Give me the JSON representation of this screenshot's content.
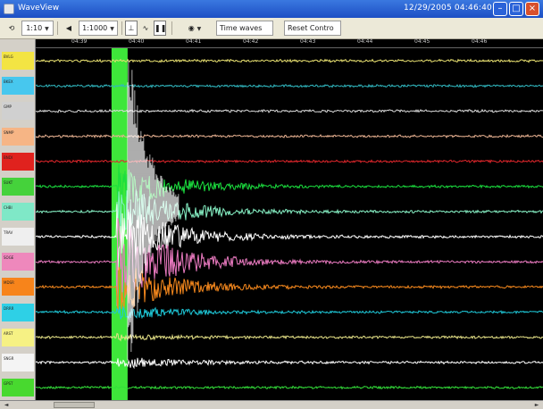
{
  "window": {
    "title": "WaveView",
    "timestamp": "12/29/2005 04:46:40",
    "minimize_icon": "minimize-icon",
    "maximize_icon": "maximize-icon",
    "close_icon": "close-icon"
  },
  "toolbar": {
    "zoom_value": "1:10",
    "scale_value": "1:1000",
    "time_button_label": "Time waves",
    "reset_button_label": "Reset Contro",
    "icons": [
      "reset-icon",
      "arrow-back-icon",
      "zoom-dropdown-icon",
      "filter-icon",
      "wave-icon",
      "pause-icon",
      "display-options-icon"
    ]
  },
  "time_axis": {
    "ticks": [
      "04:39",
      "04:40",
      "04:41",
      "04:42",
      "04:43",
      "04:44",
      "04:45",
      "04:46"
    ]
  },
  "channels": [
    {
      "name": "BVLG",
      "label_color": "#f3e443",
      "trace_color": "#e8e070",
      "amplitude": 0.0
    },
    {
      "name": "BKEX",
      "label_color": "#47c7ee",
      "trace_color": "#31b8c0",
      "amplitude": 0.0
    },
    {
      "name": "GMP",
      "label_color": "#d0d0d0",
      "trace_color": "#d8d8d8",
      "amplitude": 0.0
    },
    {
      "name": "SNMP",
      "label_color": "#f6b585",
      "trace_color": "#e9b292",
      "amplitude": 0.0
    },
    {
      "name": "BNDI",
      "label_color": "#e0221e",
      "trace_color": "#e0262b",
      "amplitude": 0.0
    },
    {
      "name": "SUKT",
      "label_color": "#45d23b",
      "trace_color": "#1bde3e",
      "amplitude": 0.45
    },
    {
      "name": "CHBI",
      "label_color": "#7fe8c7",
      "trace_color": "#86f0c4",
      "amplitude": 0.55
    },
    {
      "name": "TRAV",
      "label_color": "#efefef",
      "trace_color": "#ffffff",
      "amplitude": 0.65
    },
    {
      "name": "SOGE",
      "label_color": "#ee88bc",
      "trace_color": "#ea7ac0",
      "amplitude": 0.8
    },
    {
      "name": "MDSR",
      "label_color": "#f7841b",
      "trace_color": "#f7891d",
      "amplitude": 0.5
    },
    {
      "name": "DRRR",
      "label_color": "#2ed0e6",
      "trace_color": "#1ec8d8",
      "amplitude": 0.15
    },
    {
      "name": "ARST",
      "label_color": "#f6f184",
      "trace_color": "#e7e388",
      "amplitude": 0.05
    },
    {
      "name": "SNGR",
      "label_color": "#f4f4f4",
      "trace_color": "#ffffff",
      "amplitude": 0.12
    },
    {
      "name": "GPST",
      "label_color": "#48d92f",
      "trace_color": "#34e03a",
      "amplitude": 0.0
    }
  ],
  "event": {
    "onset_fraction": 0.16,
    "saturated_band_color": "#3ee63a"
  },
  "status": {
    "left_arrow_icon": "scroll-left-icon",
    "right_arrow_icon": "scroll-right-icon"
  }
}
